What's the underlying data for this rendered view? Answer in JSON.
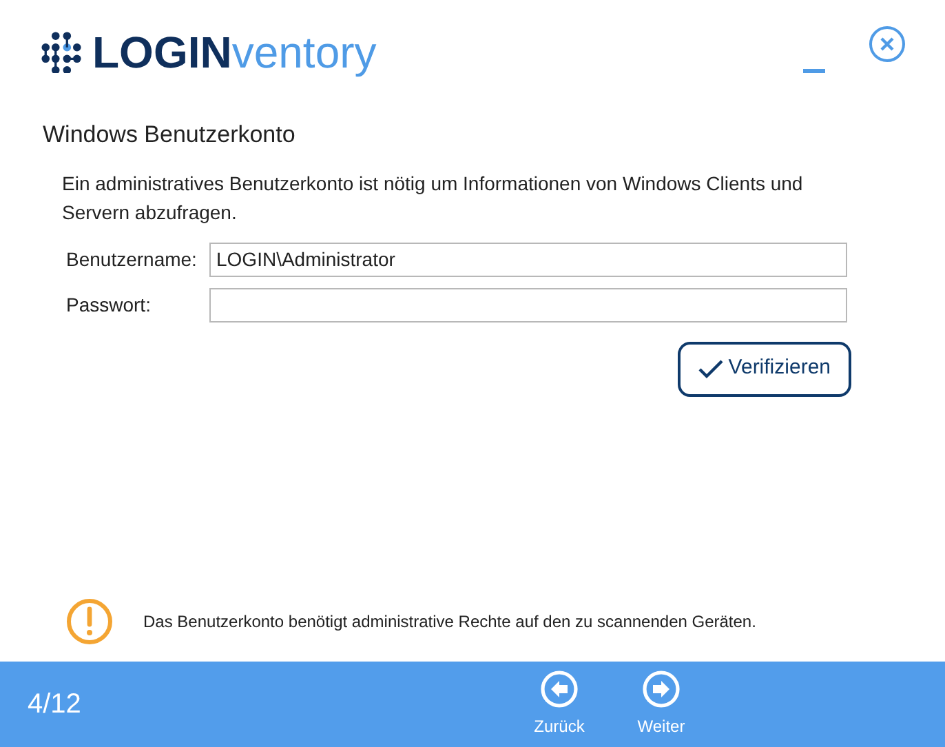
{
  "logo": {
    "part_1": "LOGIN",
    "part_2": "ventory"
  },
  "section_title": "Windows Benutzerkonto",
  "description": "Ein administratives Benutzerkonto ist nötig um Informationen von Windows Clients und Servern abzufragen.",
  "fields": [
    {
      "label": "Benutzername:",
      "value": "LOGIN\\Administrator"
    },
    {
      "label": "Passwort:"
    }
  ],
  "verify_button": "Verifizieren",
  "warning": "Das Benutzerkonto benötigt administrative Rechte auf den zu scannenden Geräten.",
  "footer": {
    "step": "4/12",
    "buttons": [
      {
        "kind": "back",
        "label": "Zurück"
      },
      {
        "kind": "next",
        "label": "Weiter"
      }
    ]
  }
}
